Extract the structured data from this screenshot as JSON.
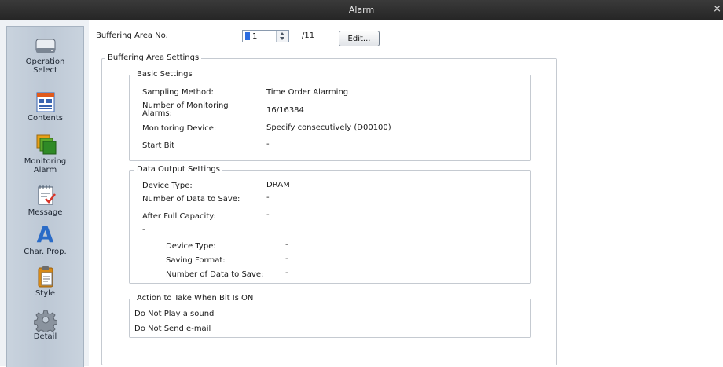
{
  "window": {
    "title": "Alarm",
    "close_glyph": "×"
  },
  "sidebar": {
    "items": [
      {
        "label": "Operation\nSelect",
        "icon": "device-icon"
      },
      {
        "label": "Contents",
        "icon": "contents-icon"
      },
      {
        "label": "Monitoring\nAlarm",
        "icon": "monitoring-alarm-icon"
      },
      {
        "label": "Message",
        "icon": "message-icon"
      },
      {
        "label": "Char. Prop.",
        "icon": "char-prop-icon",
        "glyph": "A"
      },
      {
        "label": "Style",
        "icon": "clipboard-icon"
      },
      {
        "label": "Detail",
        "icon": "gear-icon"
      }
    ]
  },
  "header": {
    "buffer_label": "Buffering Area No.",
    "buffer_value": "1",
    "buffer_total": "/11",
    "edit_button": "Edit..."
  },
  "settings": {
    "legend": "Buffering Area Settings",
    "basic": {
      "legend": "Basic Settings",
      "sampling_label": "Sampling Method:",
      "sampling_value": "Time Order Alarming",
      "monitoring_label": "Number of Monitoring\nAlarms:",
      "monitoring_value": "16/16384",
      "device_label": "Monitoring Device:",
      "device_value": "Specify consecutively (D00100)",
      "start_bit_label": "Start Bit",
      "start_bit_value": "-"
    },
    "output": {
      "legend": "Data Output Settings",
      "device_type_label": "Device Type:",
      "device_type_value": "DRAM",
      "num_save_label": "Number of Data to Save:",
      "num_save_value": "-",
      "after_full_label": "After Full Capacity:",
      "after_full_value": "-",
      "sub_value": "-",
      "sub_device_type_label": "Device Type:",
      "sub_device_type_value": "-",
      "saving_format_label": "Saving Format:",
      "saving_format_value": "-",
      "sub_num_save_label": "Number of Data to Save:",
      "sub_num_save_value": "-"
    },
    "action": {
      "legend": "Action to Take When Bit Is ON",
      "sound": "Do Not Play a sound",
      "email": "Do Not Send e-mail"
    }
  },
  "colors": {
    "titlebar": "#2e2e2e",
    "sidebar": "#c4ced9",
    "group_border": "#c5cad1"
  }
}
